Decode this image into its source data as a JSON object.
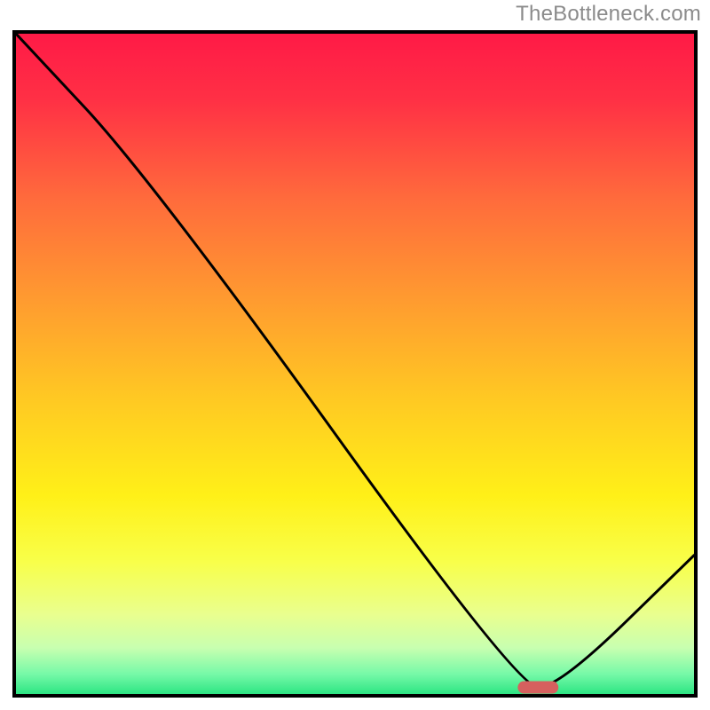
{
  "attribution": "TheBottleneck.com",
  "chart_data": {
    "type": "line",
    "title": "",
    "xlabel": "",
    "ylabel": "",
    "xlim": [
      0,
      100
    ],
    "ylim": [
      0,
      100
    ],
    "series": [
      {
        "name": "curve",
        "x": [
          0,
          20,
          74,
          80,
          100
        ],
        "values": [
          100,
          78,
          1,
          1,
          21
        ]
      }
    ],
    "marker": {
      "x_range": [
        74,
        80
      ],
      "y": 1,
      "color": "#d6605e"
    },
    "gradient_stops": [
      {
        "offset": 0.0,
        "color": "#ff1a46"
      },
      {
        "offset": 0.1,
        "color": "#ff3045"
      },
      {
        "offset": 0.25,
        "color": "#ff6b3c"
      },
      {
        "offset": 0.4,
        "color": "#ff9a30"
      },
      {
        "offset": 0.55,
        "color": "#ffc823"
      },
      {
        "offset": 0.7,
        "color": "#fff018"
      },
      {
        "offset": 0.8,
        "color": "#f8ff4a"
      },
      {
        "offset": 0.88,
        "color": "#e9ff8f"
      },
      {
        "offset": 0.93,
        "color": "#c8ffb0"
      },
      {
        "offset": 0.97,
        "color": "#76f9a8"
      },
      {
        "offset": 1.0,
        "color": "#2de583"
      }
    ]
  }
}
